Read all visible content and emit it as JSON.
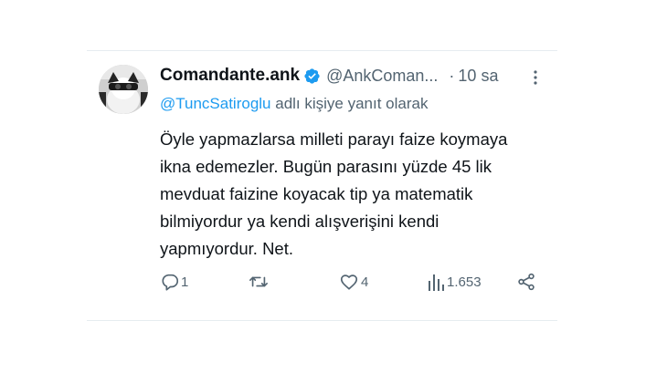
{
  "tweet": {
    "display_name": "Comandante.ank",
    "handle": "@AnkComan...",
    "separator": "·",
    "time_ago": "10 sa",
    "reply_to_user": "@TuncSatiroglu",
    "reply_suffix": " adlı kişiye yanıt olarak",
    "text": "Öyle yapmazlarsa milleti parayı faize koymaya\nikna edemezler. Bugün parasını yüzde 45 lik\nmevduat faizine koyacak tip ya matematik\nbilmiyordur ya kendi alışverişini kendi\nyapmıyordur. Net."
  },
  "actions": {
    "reply_count": "1",
    "retweet_count": "",
    "like_count": "4",
    "view_count": "1.653"
  },
  "icons": {
    "verified": "verified-badge-icon",
    "more": "more-icon",
    "reply": "reply-icon",
    "retweet": "retweet-icon",
    "like": "heart-icon",
    "views": "views-chart-icon",
    "share": "share-icon"
  },
  "colors": {
    "accent": "#1d9bf0",
    "secondary_text": "#536471",
    "divider": "#e6ecf0"
  }
}
